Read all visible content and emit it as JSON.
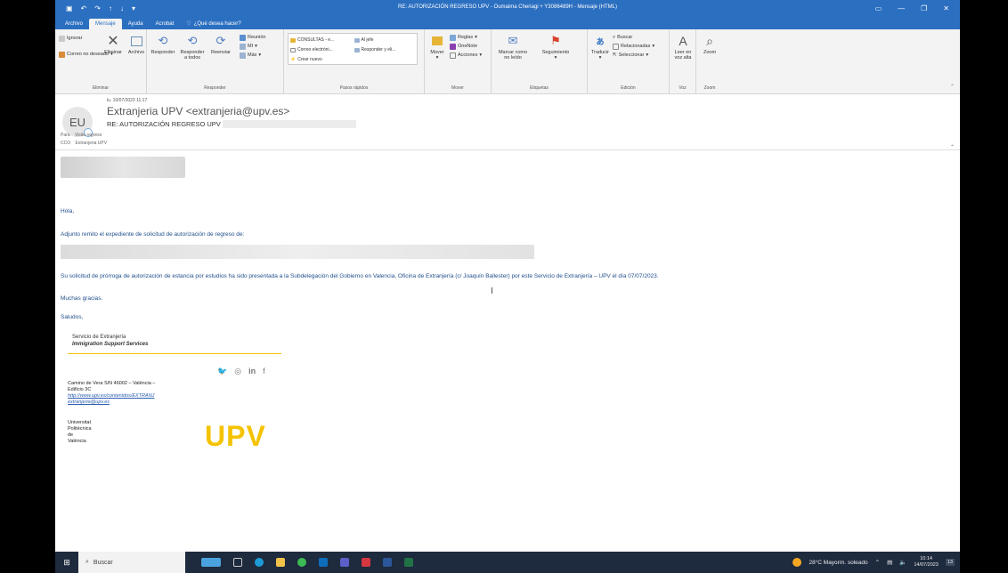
{
  "window": {
    "title": "RE: AUTORIZACIÓN REGRESO UPV - Oumaima Cheriagi + Y3086489H - Mensaje (HTML)",
    "qat_icons": [
      "save-icon",
      "undo-icon",
      "redo-icon",
      "arrow-up-icon",
      "arrow-down-icon",
      "customize-icon"
    ],
    "controls": [
      "ribbon-display-icon",
      "minimize-icon",
      "maximize-icon",
      "close-icon"
    ]
  },
  "tabs": [
    {
      "label": "Archivo",
      "active": false
    },
    {
      "label": "Mensaje",
      "active": true
    },
    {
      "label": "Ayuda",
      "active": false
    },
    {
      "label": "Acrobat",
      "active": false
    },
    {
      "label": "¿Qué desea hacer?",
      "active": false,
      "icon": "lightbulb-icon"
    }
  ],
  "ribbon": {
    "eliminar": {
      "label": "Eliminar",
      "ignorar": "Ignorar",
      "correo_no_deseado": "Correo no deseado",
      "eliminar_btn": "Eliminar",
      "archivo_btn": "Archivo"
    },
    "responder": {
      "label": "Responder",
      "responder_btn": "Responder",
      "responder_todos_1": "Responder",
      "responder_todos_2": "a todos",
      "reenviar_btn": "Reenviar",
      "reunion": "Reunión",
      "mi": "MI",
      "mas": "Más"
    },
    "pasos_rapidos": {
      "label": "Pasos rápidos",
      "items": [
        "CONSULTAS - e...",
        "Al jefe",
        "Correo electróni...",
        "Responder y eli...",
        "Crear nuevo"
      ]
    },
    "mover": {
      "label": "Mover",
      "mover_btn": "Mover",
      "reglas": "Reglas",
      "onenote": "OneNote",
      "acciones": "Acciones"
    },
    "etiquetas": {
      "label": "Etiquetas",
      "marcar_1": "Marcar como",
      "marcar_2": "no leído",
      "seguimiento": "Seguimiento"
    },
    "edicion": {
      "label": "Edición",
      "traducir": "Traducir",
      "buscar": "Buscar",
      "relacionadas": "Relacionadas",
      "seleccionar": "Seleccionar"
    },
    "voz": {
      "label": "Voz",
      "leer_1": "Leer en",
      "leer_2": "voz alta"
    },
    "zoom": {
      "label": "Zoom",
      "zoom_btn": "Zoom"
    }
  },
  "message": {
    "date": "lu. 10/07/2023 11:17",
    "avatar_initials": "EU",
    "sender": "Extranjeria UPV <extranjeria@upv.es>",
    "subject": "RE: AUTORIZACIÓN REGRESO UPV",
    "to_label": "Para",
    "to_value": "Visita regreso",
    "cc_label": "CCO",
    "cc_value": "Extranjeria UPV"
  },
  "body": {
    "greeting": "Hola,",
    "line1": "Adjunto remito el expediente de solicitud de autorización de regreso de:",
    "line2": "Su solicitud de prórroga de autorización de estancia por estudios ha sido presentada a la Subdelegación del Gobierno en Valencia, Oficina de Extranjería (c/ Joaquín Ballester) por este Servicio de Extranjería – UPV el día 07/07/2023.",
    "thanks": "Muchas gracias.",
    "closing": "Saludos,"
  },
  "signature": {
    "service": "Servicio de Extranjería",
    "service_en": "Immigration Support Services",
    "social": [
      "twitter-icon",
      "instagram-icon",
      "linkedin-icon",
      "facebook-icon"
    ],
    "address_1": "Camino de Vera S/N 46002 – València –",
    "address_2": "Edificio 3C",
    "link_web": "http://www.upv.es/contenidos/EXTRANJ",
    "link_mail": "extranjeria@upv.es",
    "univ_1": "Universitat Politècnica",
    "univ_2": "de València",
    "logo": "UPV",
    "logo_color": "#f4c300"
  },
  "taskbar": {
    "search_label": "Buscar",
    "apps": [
      "widgets-icon",
      "people-icon",
      "task-view-icon",
      "edge-icon",
      "files-icon",
      "chrome-icon",
      "outlook-icon",
      "teams-icon",
      "acrobat-icon",
      "word-icon",
      "excel-icon"
    ],
    "weather": "28°C  Mayorm. soleado",
    "time": "10:14",
    "date": "14/07/2023",
    "notifications": "13"
  },
  "colors": {
    "titlebar": "#2b6fc0",
    "body_text": "#1f4e8a",
    "accent_rule": "#f2c200"
  }
}
